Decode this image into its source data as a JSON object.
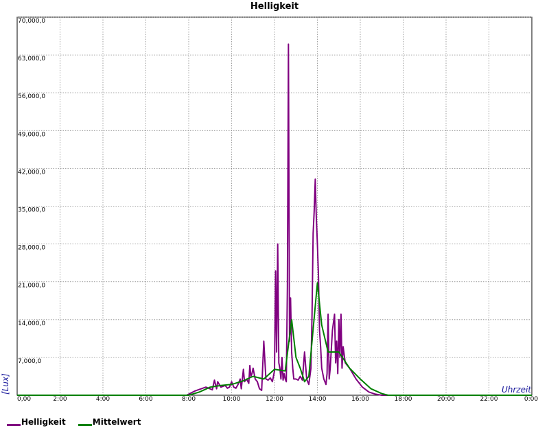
{
  "chart_data": {
    "type": "line",
    "title": "Helligkeit",
    "xlabel": "Uhrzeit",
    "ylabel": "[Lux]",
    "xlim": [
      0,
      24
    ],
    "ylim": [
      0,
      70000
    ],
    "grid": true,
    "legend_position": "bottom-left",
    "x_ticks": [
      "0,00",
      "2:00",
      "4:00",
      "6:00",
      "8:00",
      "10:00",
      "12:00",
      "14:00",
      "16:00",
      "18:00",
      "20:00",
      "22:00",
      "0:00"
    ],
    "y_ticks": [
      "7,000,0",
      "14,000,0",
      "21,000,0",
      "28,000,0",
      "35,000,0",
      "42,000,0",
      "49,000,0",
      "56,000,0",
      "63,000,0",
      "70,000,0"
    ],
    "series": [
      {
        "name": "Helligkeit",
        "color": "#800080",
        "x": [
          0,
          7.9,
          8.3,
          8.8,
          9.1,
          9.2,
          9.3,
          9.35,
          9.5,
          9.7,
          9.8,
          9.9,
          10.0,
          10.1,
          10.2,
          10.3,
          10.4,
          10.45,
          10.55,
          10.6,
          10.7,
          10.8,
          10.85,
          10.9,
          10.95,
          11.0,
          11.1,
          11.2,
          11.3,
          11.4,
          11.5,
          11.6,
          11.7,
          11.8,
          11.9,
          12.0,
          12.05,
          12.1,
          12.15,
          12.2,
          12.25,
          12.3,
          12.35,
          12.4,
          12.45,
          12.5,
          12.55,
          12.6,
          12.65,
          12.7,
          12.75,
          12.8,
          12.85,
          12.9,
          13.0,
          13.1,
          13.2,
          13.3,
          13.4,
          13.5,
          13.6,
          13.7,
          13.75,
          13.8,
          13.85,
          13.9,
          13.95,
          14.0,
          14.05,
          14.1,
          14.15,
          14.2,
          14.3,
          14.4,
          14.45,
          14.5,
          14.55,
          14.6,
          14.7,
          14.8,
          14.85,
          14.9,
          14.95,
          15.0,
          15.05,
          15.1,
          15.15,
          15.2,
          15.3,
          15.5,
          15.8,
          16.1,
          16.4,
          16.7,
          17.0,
          17.3,
          24
        ],
        "y": [
          0,
          0,
          800,
          1500,
          1000,
          2800,
          1200,
          2500,
          1500,
          1800,
          1300,
          1500,
          2500,
          1500,
          1300,
          2000,
          3000,
          1200,
          4800,
          2500,
          3000,
          2200,
          5500,
          3500,
          4000,
          5000,
          3000,
          2500,
          1200,
          900,
          10000,
          3000,
          2800,
          3200,
          2500,
          4500,
          23000,
          8000,
          28000,
          6000,
          5000,
          3000,
          7000,
          2800,
          4000,
          3000,
          2500,
          20000,
          65000,
          10000,
          18000,
          8000,
          5000,
          3000,
          3000,
          2800,
          3500,
          2800,
          8000,
          3000,
          2000,
          5000,
          15000,
          30000,
          34000,
          40000,
          33000,
          28000,
          22000,
          12000,
          9000,
          5000,
          3000,
          2000,
          4000,
          15000,
          3000,
          5000,
          12000,
          15000,
          6000,
          10000,
          4000,
          14000,
          7000,
          15000,
          5000,
          9000,
          6000,
          5000,
          3000,
          1500,
          600,
          200,
          0,
          0,
          0
        ]
      },
      {
        "name": "Mittelwert",
        "color": "#008000",
        "x": [
          0,
          8.0,
          8.5,
          9.0,
          9.5,
          10.0,
          10.5,
          11.0,
          11.5,
          12.0,
          12.5,
          12.8,
          13.0,
          13.2,
          13.4,
          13.6,
          14.0,
          14.2,
          14.5,
          15.0,
          15.5,
          16.0,
          16.5,
          17.0,
          17.3,
          24
        ],
        "y": [
          0,
          0,
          600,
          1500,
          1800,
          2000,
          2600,
          3500,
          3000,
          4800,
          4500,
          14000,
          7000,
          5000,
          2500,
          3500,
          20800,
          13000,
          8000,
          8000,
          5000,
          3000,
          1200,
          300,
          0,
          0
        ]
      }
    ]
  }
}
